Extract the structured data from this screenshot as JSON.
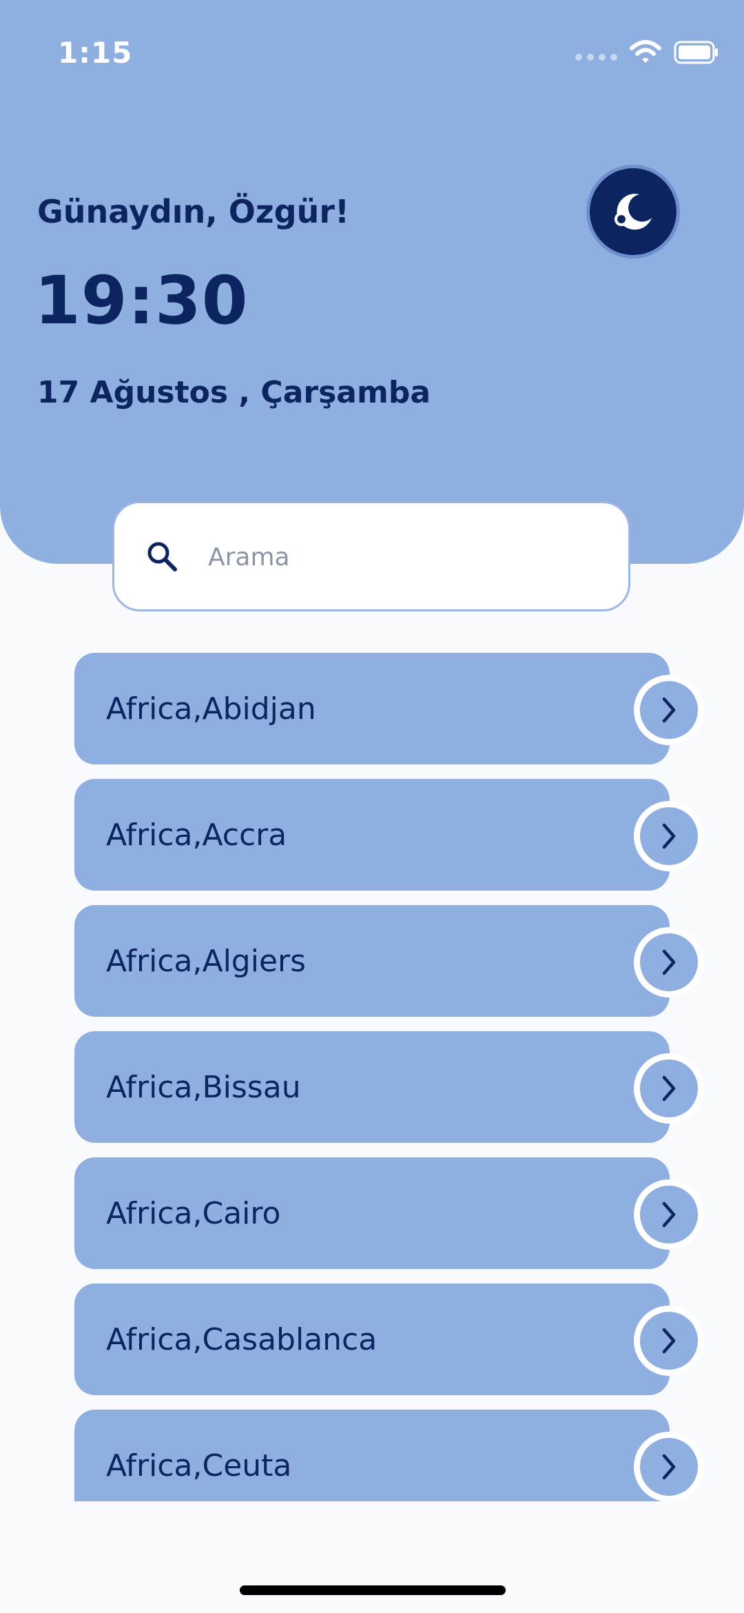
{
  "status_bar": {
    "time": "1:15"
  },
  "header": {
    "greeting": "Günaydın, Özgür!",
    "clock": "19:30",
    "date": "17 Ağustos , Çarşamba"
  },
  "search": {
    "placeholder": "Arama",
    "value": ""
  },
  "cities": [
    {
      "label": "Africa,Abidjan"
    },
    {
      "label": "Africa,Accra"
    },
    {
      "label": "Africa,Algiers"
    },
    {
      "label": "Africa,Bissau"
    },
    {
      "label": "Africa,Cairo"
    },
    {
      "label": "Africa,Casablanca"
    },
    {
      "label": "Africa,Ceuta"
    }
  ],
  "icons": {
    "theme": "moon-icon",
    "search": "search-icon",
    "chevron": "chevron-right-icon"
  },
  "colors": {
    "primary": "#8fafe0",
    "dark": "#0c2560",
    "background": "#f8fafe"
  }
}
